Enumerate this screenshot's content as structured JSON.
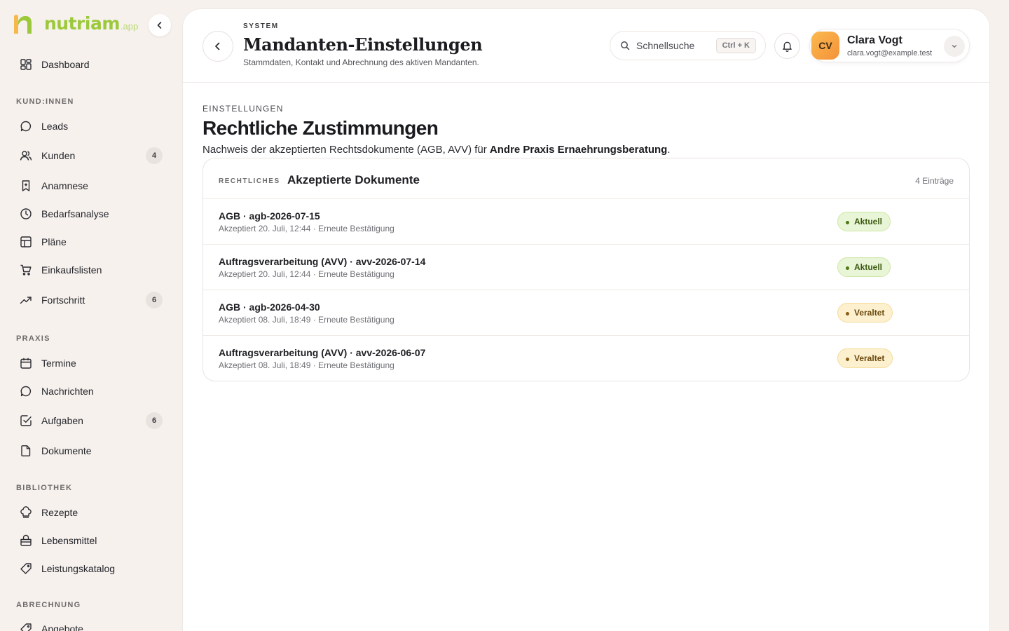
{
  "brand": {
    "name": "nutriam",
    "suffix": ".app",
    "color": "#9cc93b"
  },
  "sidebar": {
    "dashboard": "Dashboard",
    "sections": {
      "kunden": "KUND:INNEN",
      "praxis": "PRAXIS",
      "bibliothek": "BIBLIOTHEK",
      "abrechnung": "ABRECHNUNG"
    },
    "items": {
      "leads": "Leads",
      "kunden": "Kunden",
      "kunden_badge": "4",
      "anamnese": "Anamnese",
      "bedarfsanalyse": "Bedarfsanalyse",
      "plaene": "Pläne",
      "einkaufslisten": "Einkaufslisten",
      "fortschritt": "Fortschritt",
      "fortschritt_badge": "6",
      "termine": "Termine",
      "nachrichten": "Nachrichten",
      "aufgaben": "Aufgaben",
      "aufgaben_badge": "6",
      "dokumente": "Dokumente",
      "rezepte": "Rezepte",
      "lebensmittel": "Lebensmittel",
      "leistungskatalog": "Leistungskatalog",
      "angebote": "Angebote"
    }
  },
  "header": {
    "kicker": "SYSTEM",
    "title": "Mandanten-Einstellungen",
    "subtitle": "Stammdaten, Kontakt und Abrechnung des aktiven Mandanten.",
    "search_label": "Schnellsuche",
    "search_shortcut": "Ctrl + K",
    "user": {
      "initials": "CV",
      "name": "Clara Vogt",
      "email": "clara.vogt@example.test"
    }
  },
  "content": {
    "kicker": "EINSTELLUNGEN",
    "title": "Rechtliche Zustimmungen",
    "desc_prefix": "Nachweis der akzeptierten Rechtsdokumente (AGB, AVV) für ",
    "desc_org": "Andre Praxis Ernaehrungsberatung",
    "desc_suffix": ".",
    "card": {
      "kicker": "RECHTLICHES",
      "title": "Akzeptierte Dokumente",
      "count": "4 Einträge",
      "rows": [
        {
          "title": "AGB · agb-2026-07-15",
          "meta": "Akzeptiert 20. Juli, 12:44 · Erneute Bestätigung",
          "status": "Aktuell"
        },
        {
          "title": "Auftragsverarbeitung (AVV) · avv-2026-07-14",
          "meta": "Akzeptiert 20. Juli, 12:44 · Erneute Bestätigung",
          "status": "Aktuell"
        },
        {
          "title": "AGB · agb-2026-04-30",
          "meta": "Akzeptiert 08. Juli, 18:49 · Erneute Bestätigung",
          "status": "Veraltet"
        },
        {
          "title": "Auftragsverarbeitung (AVV) · avv-2026-06-07",
          "meta": "Akzeptiert 08. Juli, 18:49 · Erneute Bestätigung",
          "status": "Veraltet"
        }
      ]
    }
  },
  "colors": {
    "status_current": "#e9f5d7",
    "status_outdated": "#fdf0cf",
    "avatar": "#f4a040"
  }
}
